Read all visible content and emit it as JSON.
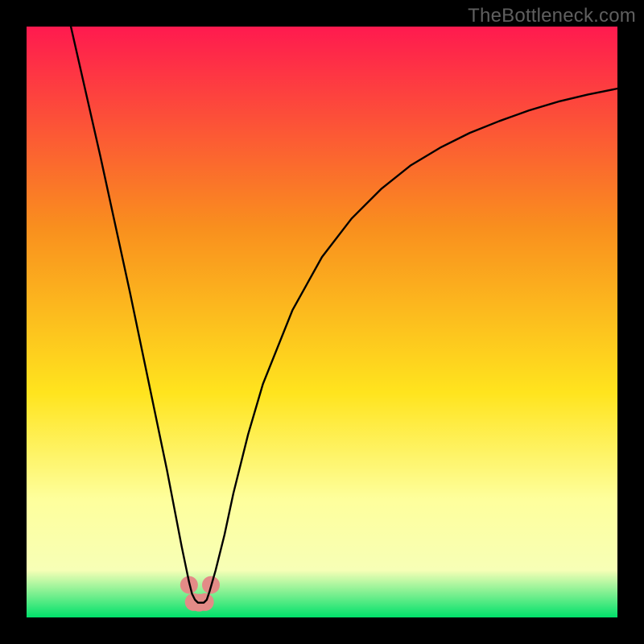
{
  "attribution": "TheBottleneck.com",
  "colors": {
    "frame": "#000000",
    "grad_top": "#ff1a4f",
    "grad_mid1": "#f98f1e",
    "grad_mid2": "#ffe41e",
    "grad_mid3": "#feff9c",
    "grad_mid4": "#f7ffb6",
    "grad_bot": "#00e06a",
    "curve": "#000000",
    "marker_fill": "#e38b87",
    "marker_stroke": "#d86f6e"
  },
  "chart_data": {
    "type": "line",
    "title": "",
    "xlabel": "",
    "ylabel": "",
    "xlim": [
      0,
      100
    ],
    "ylim": [
      0,
      100
    ],
    "series": [
      {
        "name": "curve",
        "x": [
          7.5,
          10,
          12.5,
          15,
          17.5,
          20,
          22.5,
          23.75,
          25,
          26.25,
          27.5,
          28,
          28.5,
          29,
          29.5,
          30,
          30.5,
          31,
          32,
          33.5,
          35,
          37.5,
          40,
          45,
          50,
          55,
          60,
          65,
          70,
          75,
          80,
          85,
          90,
          95,
          100
        ],
        "y": [
          100,
          89,
          78,
          66.5,
          55,
          43,
          31,
          25,
          18.5,
          12,
          6,
          4,
          3,
          2.5,
          2.5,
          2.5,
          3,
          4.5,
          8,
          14,
          21,
          31,
          39.5,
          52,
          61,
          67.5,
          72.5,
          76.5,
          79.5,
          82,
          84,
          85.8,
          87.3,
          88.5,
          89.5
        ]
      }
    ],
    "markers": [
      {
        "x": 27.5,
        "y": 5.5
      },
      {
        "x": 28.3,
        "y": 2.6
      },
      {
        "x": 29.2,
        "y": 2.5
      },
      {
        "x": 30.2,
        "y": 2.6
      },
      {
        "x": 31.2,
        "y": 5.5
      }
    ]
  }
}
